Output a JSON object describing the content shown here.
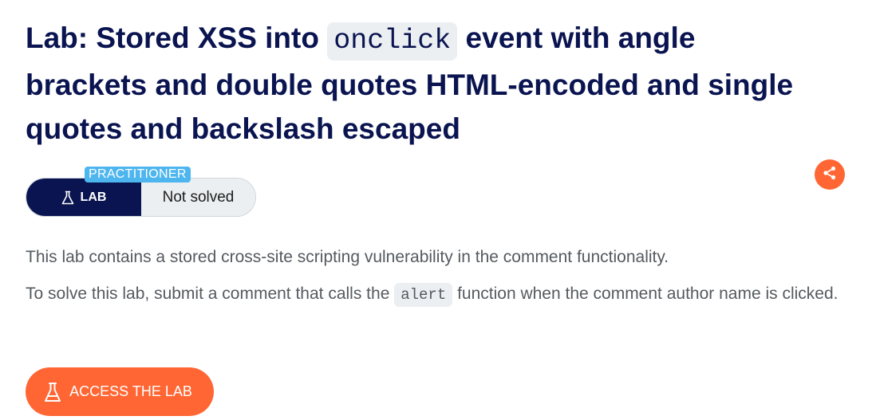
{
  "title": {
    "before_code": "Lab: Stored XSS into ",
    "code": "onclick",
    "after_code": " event with angle brackets and double quotes HTML-encoded and single quotes and backslash escaped"
  },
  "badge": {
    "level": "PRACTITIONER",
    "type_label": "LAB",
    "status": "Not solved"
  },
  "description": {
    "paragraph1": "This lab contains a stored cross-site scripting vulnerability in the comment functionality.",
    "paragraph2_before": "To solve this lab, submit a comment that calls the ",
    "paragraph2_code": "alert",
    "paragraph2_after": " function when the comment author name is clicked."
  },
  "actions": {
    "access_label": "ACCESS THE LAB"
  },
  "icons": {
    "share": "share-icon",
    "flask": "flask-icon"
  },
  "colors": {
    "heading": "#0a1450",
    "accent_orange": "#ff6633",
    "level_tag": "#4eb6ef",
    "body_text": "#555a5f",
    "code_bg": "#ebeff2"
  }
}
